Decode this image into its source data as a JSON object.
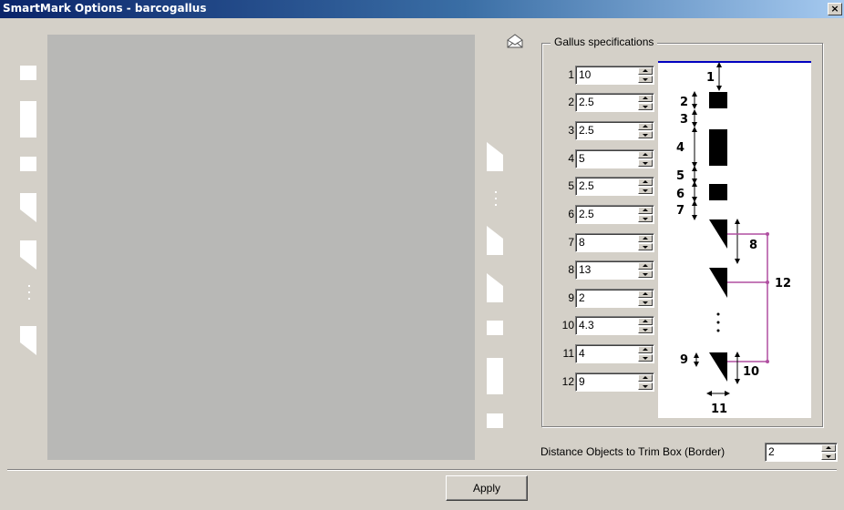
{
  "window": {
    "title": "SmartMark Options - barcogallus",
    "close_glyph": "×"
  },
  "group": {
    "legend": "Gallus specifications"
  },
  "specs": [
    {
      "label": "1",
      "value": "10"
    },
    {
      "label": "2",
      "value": "2.5"
    },
    {
      "label": "3",
      "value": "2.5"
    },
    {
      "label": "4",
      "value": "5"
    },
    {
      "label": "5",
      "value": "2.5"
    },
    {
      "label": "6",
      "value": "2.5"
    },
    {
      "label": "7",
      "value": "8"
    },
    {
      "label": "8",
      "value": "13"
    },
    {
      "label": "9",
      "value": "2"
    },
    {
      "label": "10",
      "value": "4.3"
    },
    {
      "label": "11",
      "value": "4"
    },
    {
      "label": "12",
      "value": "9"
    }
  ],
  "diagram": {
    "labels": {
      "n1": "1",
      "n2": "2",
      "n3": "3",
      "n4": "4",
      "n5": "5",
      "n6": "6",
      "n7": "7",
      "n8": "8",
      "n9": "9",
      "n10": "10",
      "n11": "11",
      "n12": "12"
    },
    "colors": {
      "top_line": "#0000c0",
      "bracket": "#b04fa0",
      "marks": "#000000"
    }
  },
  "distance": {
    "label": "Distance Objects to Trim Box (Border)",
    "value": "2"
  },
  "buttons": {
    "apply": "Apply"
  },
  "icons": {
    "mail": "envelope-icon",
    "close": "close-icon"
  }
}
